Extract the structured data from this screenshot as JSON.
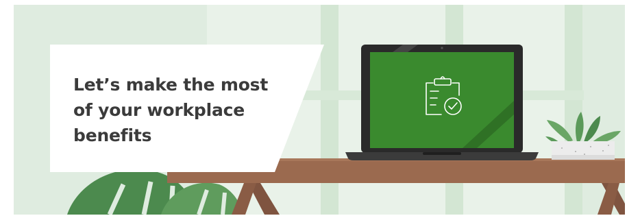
{
  "banner": {
    "headline": "Let’s make the most\nof your workplace\nbenefits"
  },
  "illustration": {
    "screen_icon": "clipboard-check-icon",
    "colors": {
      "background": "#dfece0",
      "window_pane": "#e8f2e8",
      "window_frame": "#d0e4d1",
      "screen": "#3a8a2e",
      "laptop_body": "#2a2a2a",
      "desk": "#9b6a4f",
      "desk_legs": "#7f5440",
      "planter": "#ececec",
      "plant_leaf": "#5b9a5a",
      "monstera": "#4c8a4e",
      "headline_text": "#3b3b3b"
    }
  }
}
